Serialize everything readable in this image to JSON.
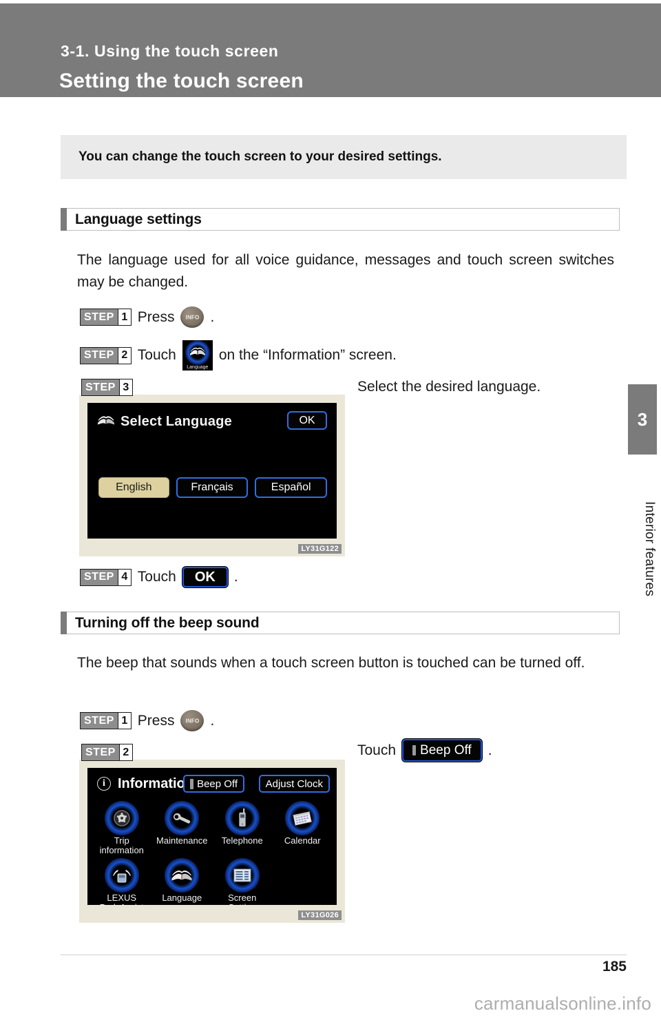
{
  "header": {
    "chapter_line": "3-1. Using the touch screen",
    "title": "Setting the touch screen",
    "band_color": "#7b7b7b"
  },
  "intro": {
    "text": "You can change the touch screen to your desired settings."
  },
  "sections": [
    {
      "heading": "Language settings",
      "body": "The language used for all voice guidance, messages and touch screen switches may be changed.",
      "steps": [
        {
          "word": "STEP",
          "number": "1",
          "action": "Press",
          "trailing": "."
        },
        {
          "word": "STEP",
          "number": "2",
          "action": "Touch",
          "trailing": "on the “Information” screen."
        },
        {
          "word": "STEP",
          "number": "3",
          "action": "",
          "caption": "Select the desired language."
        },
        {
          "word": "STEP",
          "number": "4",
          "action": "Touch",
          "trailing": "."
        }
      ]
    },
    {
      "heading": "Turning off the beep sound",
      "body": "The beep that sounds when a touch screen button is touched can be turned off.",
      "steps": [
        {
          "word": "STEP",
          "number": "1",
          "action": "Press",
          "trailing": "."
        },
        {
          "word": "STEP",
          "number": "2",
          "action": "",
          "caption": "Touch",
          "caption_trailing": "."
        }
      ]
    }
  ],
  "buttons": {
    "info_label": "INFO",
    "ok_label": "OK",
    "beep_off_label": "Beep Off",
    "language_tile_label": "Language"
  },
  "figure_select_language": {
    "code": "LY31G122",
    "title": "Select Language",
    "ok_label": "OK",
    "languages": [
      {
        "label": "English",
        "selected": true
      },
      {
        "label": "Français",
        "selected": false
      },
      {
        "label": "Español",
        "selected": false
      }
    ]
  },
  "figure_information": {
    "code": "LY31G026",
    "title": "Information",
    "top_buttons": [
      {
        "label": "Beep Off",
        "has_indicator": true
      },
      {
        "label": "Adjust Clock",
        "has_indicator": false
      }
    ],
    "icons": [
      {
        "label": "Trip\ninformation",
        "icon": "wheel-icon"
      },
      {
        "label": "Maintenance",
        "icon": "wrench-icon"
      },
      {
        "label": "Telephone",
        "icon": "phone-icon"
      },
      {
        "label": "Calendar",
        "icon": "calendar-icon"
      },
      {
        "label": "LEXUS\nPark Assist",
        "icon": "park-assist-icon"
      },
      {
        "label": "Language",
        "icon": "book-icon"
      },
      {
        "label": "Screen\nSetting",
        "icon": "screen-setting-icon"
      }
    ]
  },
  "chapter_tab": {
    "number": "3",
    "label": "Interior features"
  },
  "footer": {
    "page_number": "185",
    "watermark": "carmanualsonline.info"
  },
  "colors": {
    "band_gray": "#7b7b7b",
    "intro_gray": "#eaeaea",
    "screen_black": "#000000",
    "bezel_cream": "#eae7d8",
    "button_blue": "#2f6fe0",
    "selected_khaki": "#ddd1a0"
  }
}
